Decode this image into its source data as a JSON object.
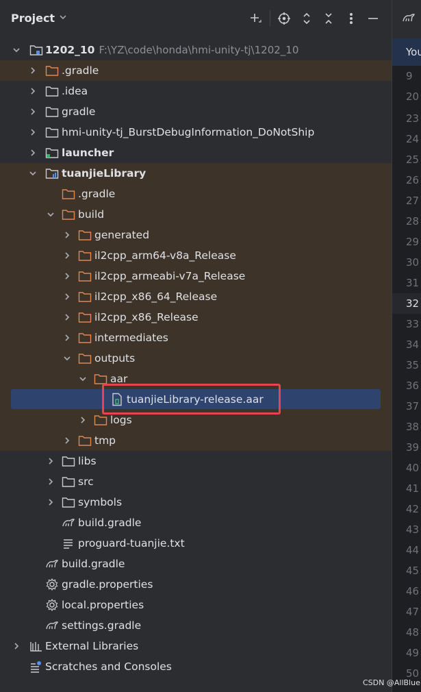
{
  "header": {
    "title": "Project"
  },
  "tree": {
    "root_name": "1202_10",
    "root_path": "F:\\YZ\\code\\honda\\hmi-unity-tj\\1202_10",
    "items": [
      ".gradle",
      ".idea",
      "gradle",
      "hmi-unity-tj_BurstDebugInformation_DoNotShip",
      "launcher",
      "tuanjieLibrary",
      ".gradle",
      "build",
      "generated",
      "il2cpp_arm64-v8a_Release",
      "il2cpp_armeabi-v7a_Release",
      "il2cpp_x86_64_Release",
      "il2cpp_x86_Release",
      "intermediates",
      "outputs",
      "aar",
      "tuanjieLibrary-release.aar",
      "logs",
      "tmp",
      "libs",
      "src",
      "symbols",
      "build.gradle",
      "proguard-tuanjie.txt",
      "build.gradle",
      "gradle.properties",
      "local.properties",
      "settings.gradle",
      "External Libraries",
      "Scratches and Consoles"
    ]
  },
  "editor": {
    "notice_text": "You",
    "line_numbers": [
      "9",
      "20",
      "23",
      "24",
      "25",
      "26",
      "27",
      "28",
      "29",
      "30",
      "31",
      "32",
      "33",
      "34",
      "35",
      "36",
      "37",
      "38",
      "39",
      "40",
      "41",
      "42",
      "43",
      "44",
      "45",
      "46",
      "47",
      "48",
      "49",
      "50"
    ]
  },
  "watermark": "CSDN @AllBlue",
  "colors": {
    "background": "#2b2d30",
    "selection": "#2e436e",
    "excluded": "#3d3329",
    "highlight_box": "#e5454f",
    "folder_orange": "#e08855"
  }
}
